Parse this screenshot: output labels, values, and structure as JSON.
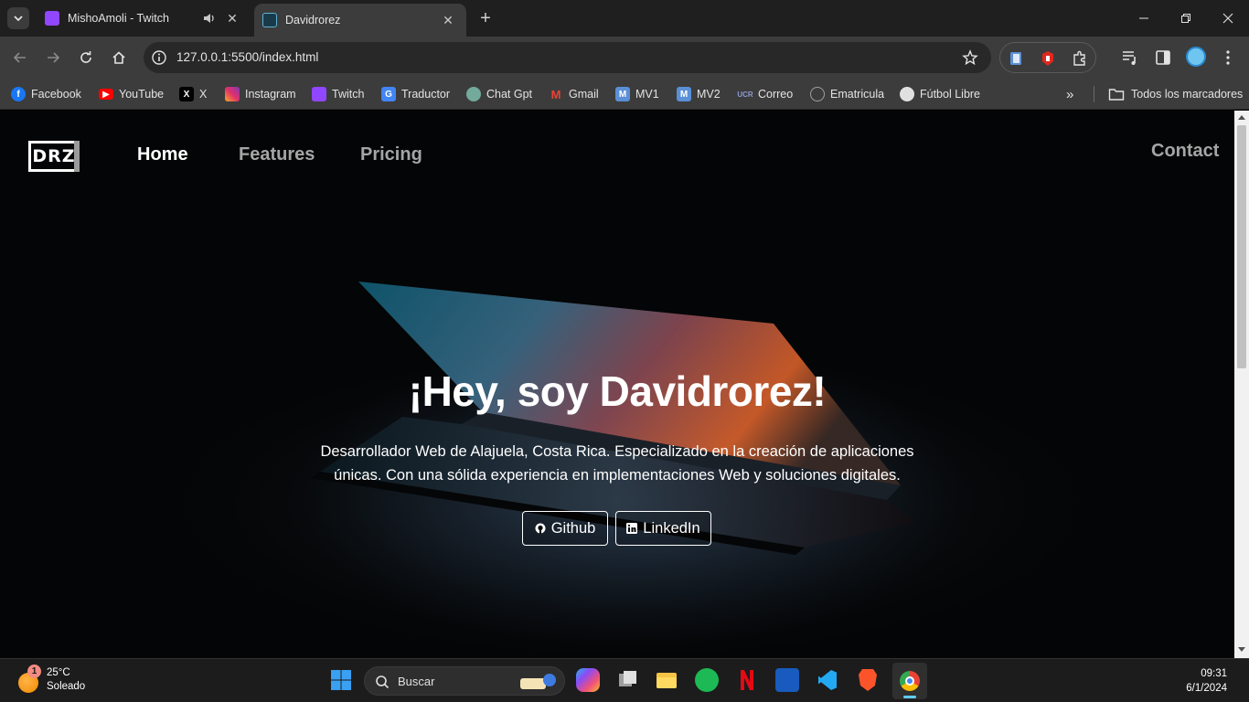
{
  "browser": {
    "tabs": [
      {
        "title": "MishoAmoli - Twitch",
        "active": false,
        "audio": true
      },
      {
        "title": "Davidrorez",
        "active": true,
        "audio": false
      }
    ],
    "url": "127.0.0.1:5500/index.html",
    "bookmarks": [
      {
        "label": "Facebook",
        "icon": "facebook-icon",
        "color": "#1877f2"
      },
      {
        "label": "YouTube",
        "icon": "youtube-icon",
        "color": "#ff0000"
      },
      {
        "label": "X",
        "icon": "x-icon",
        "color": "#000000"
      },
      {
        "label": "Instagram",
        "icon": "instagram-icon",
        "color": "#e1306c"
      },
      {
        "label": "Twitch",
        "icon": "twitch-icon",
        "color": "#9146ff"
      },
      {
        "label": "Traductor",
        "icon": "translate-icon",
        "color": "#4285f4"
      },
      {
        "label": "Chat Gpt",
        "icon": "chatgpt-icon",
        "color": "#74aa9c"
      },
      {
        "label": "Gmail",
        "icon": "gmail-icon",
        "color": "#ea4335"
      },
      {
        "label": "MV1",
        "icon": "mv-icon",
        "color": "#5b8fd6"
      },
      {
        "label": "MV2",
        "icon": "mv-icon",
        "color": "#5b8fd6"
      },
      {
        "label": "Correo",
        "icon": "mail-icon",
        "color": "#6b7bb0"
      },
      {
        "label": "Ematricula",
        "icon": "globe-icon",
        "color": "#9aa0a6"
      },
      {
        "label": "Fútbol Libre",
        "icon": "soccer-ball-icon",
        "color": "#e0e0e0"
      }
    ],
    "all_bookmarks_label": "Todos los marcadores"
  },
  "site": {
    "logo": "DRZ",
    "nav": {
      "home": "Home",
      "features": "Features",
      "pricing": "Pricing",
      "contact": "Contact"
    },
    "hero": {
      "title": "¡Hey, soy Davidrorez!",
      "subtitle": "Desarrollador Web de Alajuela, Costa Rica. Especializado en la creación de aplicaciones únicas. Con una sólida experiencia en implementaciones Web y soluciones digitales.",
      "github_label": "Github",
      "linkedin_label": "LinkedIn"
    }
  },
  "taskbar": {
    "weather_temp": "25°C",
    "weather_condition": "Soleado",
    "weather_badge": "1",
    "search_label": "Buscar",
    "time": "09:31",
    "date": "6/1/2024"
  }
}
